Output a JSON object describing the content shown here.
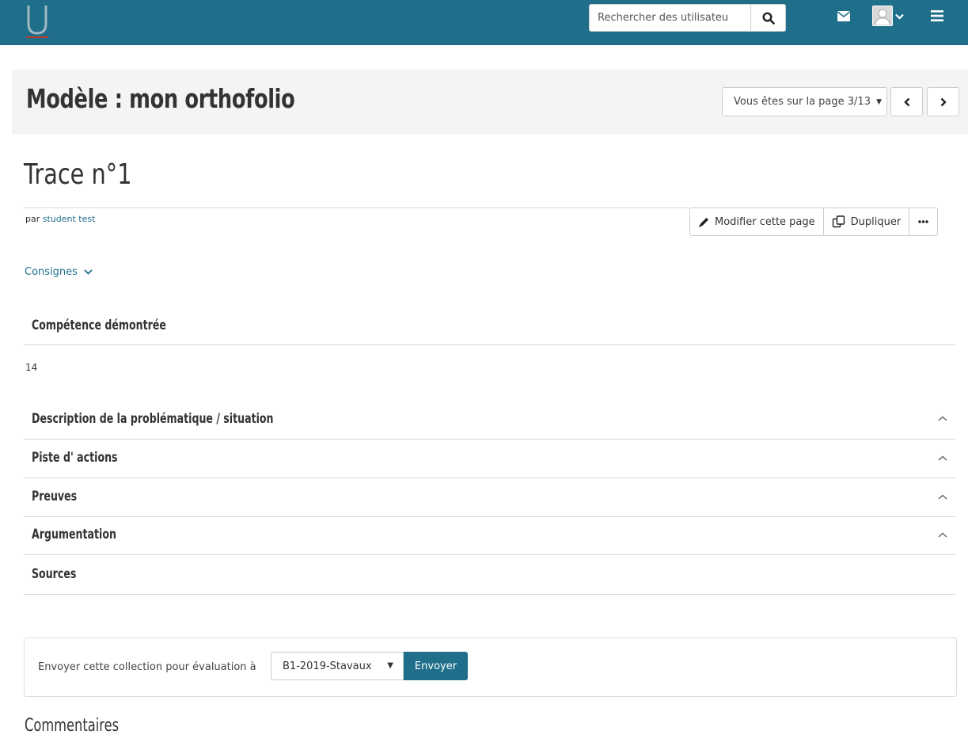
{
  "header": {
    "search": {
      "placeholder": "Rechercher des utilisateu"
    },
    "icons": [
      "logo-u",
      "search-icon",
      "mail-icon",
      "user-avatar-icon",
      "chevron-down-icon",
      "hamburger-menu-icon"
    ]
  },
  "collection": {
    "title": "Modèle : mon orthofolio",
    "page_indicator": "Vous êtes sur la page 3/13"
  },
  "page": {
    "heading": "Trace n°1",
    "author_prefix": "par",
    "author_name": "student test",
    "actions": {
      "edit_label": "Modifier cette page",
      "duplicate_label": "Dupliquer"
    },
    "instructions_label": "Consignes"
  },
  "blocks": [
    {
      "title": "Compétence démontrée",
      "value": "14"
    },
    {
      "title": "Description de la problématique / situation"
    },
    {
      "title": "Piste d' actions"
    },
    {
      "title": "Preuves"
    },
    {
      "title": "Argumentation"
    },
    {
      "title": "Sources"
    }
  ],
  "submission": {
    "label": "Envoyer cette collection pour évaluation à",
    "selected_group": "B1-2019-Stavaux",
    "submit_label": "Envoyer"
  },
  "comments": {
    "heading": "Commentaires"
  },
  "colors": {
    "brand": "#1f6f8b",
    "title_band": "#f4f4f4",
    "link": "#1f6f8b"
  }
}
